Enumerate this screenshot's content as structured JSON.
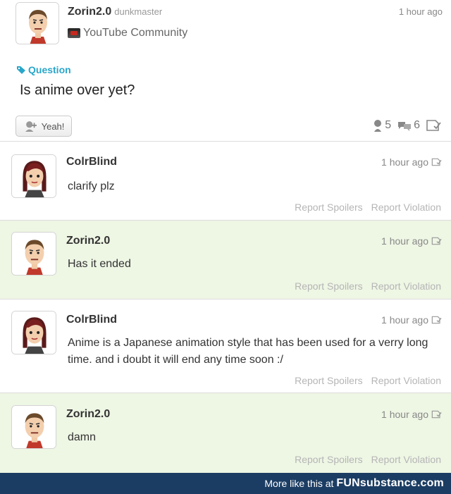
{
  "post": {
    "username": "Zorin2.0",
    "handle": "dunkmaster",
    "time": "1 hour ago",
    "community": "YouTube Community",
    "tag": "Question",
    "body": "Is anime over yet?",
    "yeah_label": "Yeah!",
    "yeah_count": "5",
    "comment_count": "6"
  },
  "comments": [
    {
      "username": "ColrBlind",
      "time": "1 hour ago",
      "body": "clarify plz",
      "report_spoilers": "Report Spoilers",
      "report_violation": "Report Violation"
    },
    {
      "username": "Zorin2.0",
      "time": "1 hour ago",
      "body": "Has it ended",
      "report_spoilers": "Report Spoilers",
      "report_violation": "Report Violation"
    },
    {
      "username": "ColrBlind",
      "time": "1 hour ago",
      "body": "Anime is a Japanese animation style that has been used for a verry long time. and i doubt it will end any time soon :/",
      "report_spoilers": "Report Spoilers",
      "report_violation": "Report Violation"
    },
    {
      "username": "Zorin2.0",
      "time": "1 hour ago",
      "body": "damn",
      "report_spoilers": "Report Spoilers",
      "report_violation": "Report Violation"
    }
  ],
  "footer": {
    "text": "More like this at",
    "brand": "FUNsubstance.com"
  },
  "colors": {
    "tag_accent": "#2aa6c9",
    "op_reply_background": "#eef6e4",
    "footer_background": "#1c3d63"
  }
}
